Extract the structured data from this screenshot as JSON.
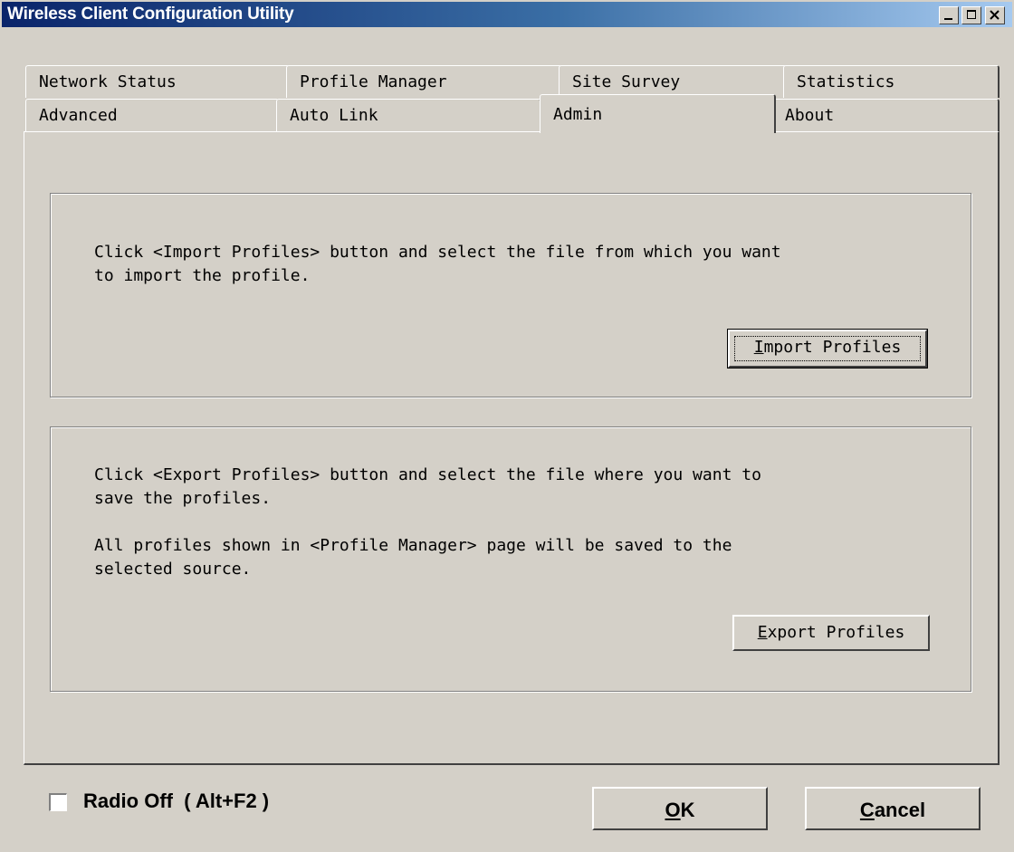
{
  "window": {
    "title": "Wireless Client Configuration Utility"
  },
  "caption_buttons": {
    "minimize": "minimize-icon",
    "maximize": "maximize-icon",
    "close": "close-icon"
  },
  "tabs": {
    "row1": [
      {
        "label": "Network Status"
      },
      {
        "label": "Profile Manager"
      },
      {
        "label": "Site Survey"
      },
      {
        "label": "Statistics"
      }
    ],
    "row2": [
      {
        "label": "Advanced"
      },
      {
        "label": "Auto Link"
      },
      {
        "label": "Admin",
        "active": true
      },
      {
        "label": "About"
      }
    ]
  },
  "import_section": {
    "description": "Click <Import Profiles> button and select the file from which you want\nto import the profile.",
    "button": {
      "accel": "I",
      "rest": "mport Profiles"
    }
  },
  "export_section": {
    "description": "Click <Export Profiles> button and select the file where you want to\nsave the profiles.\n\nAll profiles shown in <Profile Manager> page will be saved to the\nselected source.",
    "button": {
      "accel": "E",
      "rest": "xport Profiles"
    }
  },
  "footer": {
    "radio_off": {
      "label": "Radio Off  ( Alt+F2 )",
      "checked": false
    },
    "ok": {
      "accel": "O",
      "rest": "K"
    },
    "cancel": {
      "accel": "C",
      "rest": "ancel"
    }
  }
}
